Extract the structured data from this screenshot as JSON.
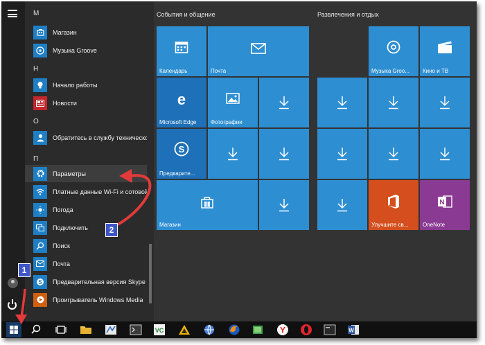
{
  "start_menu": {
    "app_list": [
      {
        "type": "letter",
        "text": "M"
      },
      {
        "type": "app",
        "label": "Магазин",
        "icon": "store-icon",
        "color": "blue"
      },
      {
        "type": "app",
        "label": "Музыка Groove",
        "icon": "groove-music-icon",
        "color": "blue"
      },
      {
        "type": "letter",
        "text": "Н"
      },
      {
        "type": "app",
        "label": "Начало работы",
        "icon": "lightbulb-icon",
        "color": "blue"
      },
      {
        "type": "app",
        "label": "Новости",
        "icon": "news-icon",
        "color": "red"
      },
      {
        "type": "letter",
        "text": "О"
      },
      {
        "type": "app",
        "label": "Обратитесь в службу техническо...",
        "icon": "support-person-icon",
        "color": "blue"
      },
      {
        "type": "letter",
        "text": "П"
      },
      {
        "type": "app",
        "label": "Параметры",
        "icon": "gear-icon",
        "color": "blue",
        "selected": true
      },
      {
        "type": "app",
        "label": "Платные данные Wi-Fi и сотовой...",
        "icon": "wifi-data-icon",
        "color": "blue"
      },
      {
        "type": "app",
        "label": "Погода",
        "icon": "weather-sun-icon",
        "color": "blue"
      },
      {
        "type": "app",
        "label": "Подключить",
        "icon": "connect-icon",
        "color": "blue"
      },
      {
        "type": "app",
        "label": "Поиск",
        "icon": "search-icon",
        "color": "blue"
      },
      {
        "type": "app",
        "label": "Почта",
        "icon": "mail-icon",
        "color": "blue"
      },
      {
        "type": "app",
        "label": "Предварительная версия Skype",
        "icon": "skype-icon",
        "color": "blue"
      },
      {
        "type": "app",
        "label": "Проигрыватель Windows Media",
        "icon": "media-player-icon",
        "color": "orange"
      }
    ],
    "groups": [
      {
        "title": "События и общение"
      },
      {
        "title": "Развлечения и отдых"
      }
    ],
    "tiles": {
      "calendar": "Календарь",
      "mail": "Почта",
      "edge": "Microsoft Edge",
      "photos": "Фотографии",
      "skype": "Предварите...",
      "store": "Магазин",
      "groove": "Музыка Groo...",
      "movies": "Кино и ТВ",
      "office": "Улучшите св...",
      "onenote": "OneNote"
    }
  },
  "annotations": {
    "badge1": "1",
    "badge2": "2"
  },
  "colors": {
    "tile_blue": "#2d8ed2",
    "tile_dark_blue": "#1e71b8",
    "office_orange": "#d44f1d",
    "onenote_purple": "#8a3a92",
    "arrow_red": "#e23a3a",
    "badge_blue": "#3f56c9"
  }
}
